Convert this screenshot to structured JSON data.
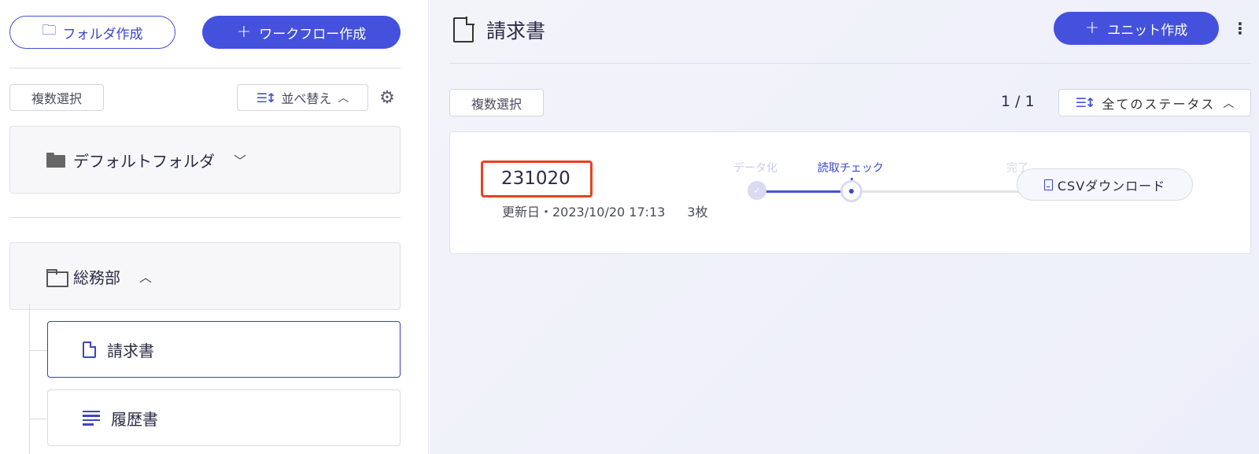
{
  "sidebar": {
    "create_folder_label": "フォルダ作成",
    "create_workflow_label": "ワークフロー作成",
    "multi_select_label": "複数選択",
    "sort_label": "並べ替え",
    "folders": [
      {
        "name": "デフォルトフォルダ",
        "expanded": false
      },
      {
        "name": "総務部",
        "expanded": true
      }
    ],
    "workflows": [
      {
        "name": "請求書",
        "icon": "document-icon",
        "active": true
      },
      {
        "name": "履歴書",
        "icon": "lines-icon",
        "active": false
      }
    ]
  },
  "main": {
    "title": "請求書",
    "create_unit_label": "ユニット作成",
    "multi_select_label": "複数選択",
    "pager": "1 / 1",
    "status_filter_label": "全てのステータス",
    "units": [
      {
        "name": "231020",
        "updated": "更新日・2023/10/20 17:13",
        "pages": "3枚",
        "steps": [
          "データ化",
          "読取チェック",
          "完了"
        ],
        "current_step": 1,
        "csv_label": "CSVダウンロード"
      }
    ]
  },
  "colors": {
    "primary": "#4451dc",
    "highlight": "#e5421f"
  }
}
